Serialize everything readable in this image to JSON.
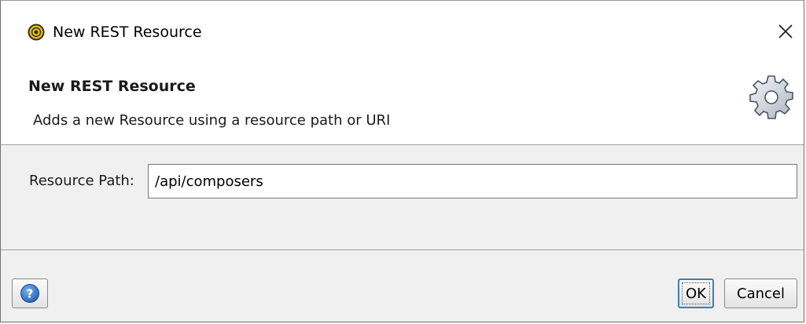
{
  "window": {
    "title": "New REST Resource",
    "app_icon": "soapui-icon",
    "close_glyph": "✕"
  },
  "banner": {
    "title": "New REST Resource",
    "description": "Adds a new Resource using a resource path or URI",
    "icon": "gear-icon"
  },
  "form": {
    "resource_path_label": "Resource Path:",
    "resource_path_value": "/api/composers"
  },
  "footer": {
    "help_icon": "help-icon",
    "ok_label": "OK",
    "cancel_label": "Cancel"
  },
  "colors": {
    "accent_blue": "#3c7fb1",
    "help_blue": "#1f5fb4",
    "app_icon_yellow": "#f2c200"
  }
}
